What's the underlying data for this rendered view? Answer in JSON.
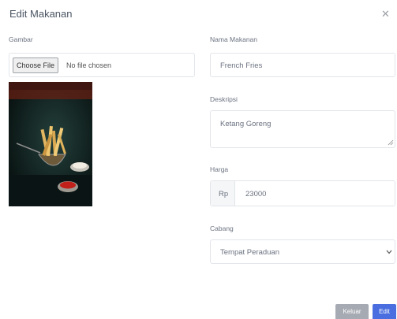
{
  "modal": {
    "title": "Edit Makanan",
    "close_icon": "close-icon"
  },
  "form": {
    "gambar": {
      "label": "Gambar",
      "button_label": "Choose File",
      "file_status": "No file chosen"
    },
    "nama": {
      "label": "Nama Makanan",
      "value": "French Fries"
    },
    "deskripsi": {
      "label": "Deskripsi",
      "value": "Ketang Goreng"
    },
    "harga": {
      "label": "Harga",
      "prefix": "Rp",
      "value": "23000"
    },
    "cabang": {
      "label": "Cabang",
      "selected": "Tempat Peraduan"
    }
  },
  "footer": {
    "keluar_label": "Keluar",
    "edit_label": "Edit"
  },
  "colors": {
    "keluar_bg": "#a6aab2",
    "edit_bg": "#4a6ee0"
  }
}
